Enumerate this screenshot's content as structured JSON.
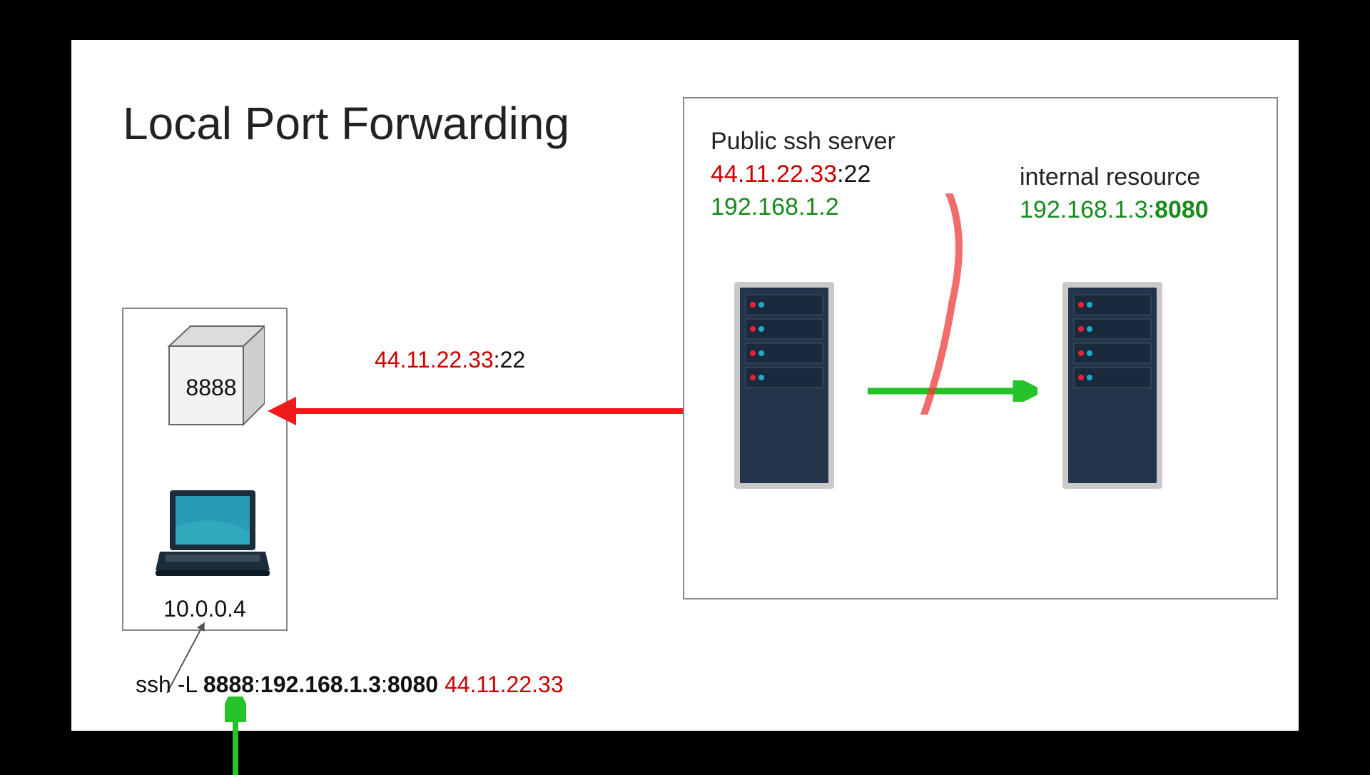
{
  "title": "Local Port Forwarding",
  "client": {
    "local_port": "8888",
    "ip": "10.0.0.4"
  },
  "connection_label": {
    "ip": "44.11.22.33",
    "port": ":22"
  },
  "ssh_server": {
    "name": "Public ssh server",
    "public_ip": "44.11.22.33",
    "public_port": ":22",
    "private_ip": "192.168.1.2"
  },
  "internal_resource": {
    "name": "internal resource",
    "ip": "192.168.1.3:",
    "port": "8080"
  },
  "command": {
    "prefix": "ssh -L ",
    "local_port": "8888",
    "sep1": ":",
    "dest_host": "192.168.1.3",
    "sep2": ":",
    "dest_port": "8080",
    "space": " ",
    "target": "44.11.22.33"
  },
  "colors": {
    "red": "#cc0000",
    "green": "#188a1e",
    "arrow_green": "#26c22a"
  }
}
